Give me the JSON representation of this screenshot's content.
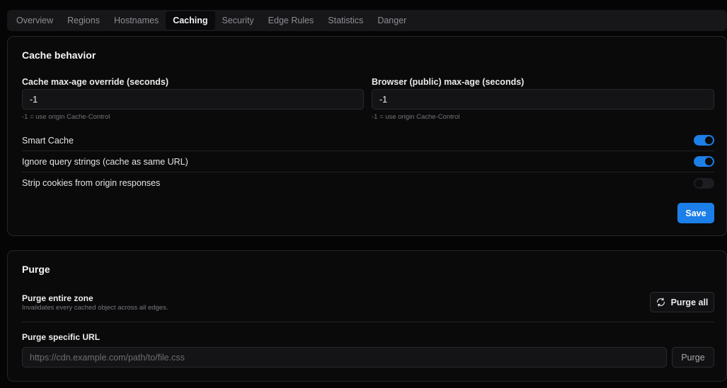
{
  "tabs": [
    {
      "label": "Overview",
      "active": false
    },
    {
      "label": "Regions",
      "active": false
    },
    {
      "label": "Hostnames",
      "active": false
    },
    {
      "label": "Caching",
      "active": true
    },
    {
      "label": "Security",
      "active": false
    },
    {
      "label": "Edge Rules",
      "active": false
    },
    {
      "label": "Statistics",
      "active": false
    },
    {
      "label": "Danger",
      "active": false
    }
  ],
  "cache_behavior": {
    "title": "Cache behavior",
    "max_age": {
      "label": "Cache max-age override (seconds)",
      "value": "-1",
      "hint": "-1 = use origin Cache-Control"
    },
    "browser_max_age": {
      "label": "Browser (public) max-age (seconds)",
      "value": "-1",
      "hint": "-1 = use origin Cache-Control"
    },
    "toggles": [
      {
        "label": "Smart Cache",
        "on": true
      },
      {
        "label": "Ignore query strings (cache as same URL)",
        "on": true
      },
      {
        "label": "Strip cookies from origin responses",
        "on": false
      }
    ],
    "save_label": "Save"
  },
  "purge": {
    "title": "Purge",
    "entire_zone": {
      "title": "Purge entire zone",
      "description": "Invalidates every cached object across all edges.",
      "button_label": "Purge all",
      "button_icon": "refresh-icon"
    },
    "specific_url": {
      "title": "Purge specific URL",
      "placeholder": "https://cdn.example.com/path/to/file.css",
      "value": "",
      "button_label": "Purge"
    }
  },
  "colors": {
    "accent": "#1d7fe8",
    "background": "#050505",
    "card": "#0a0a0b"
  }
}
